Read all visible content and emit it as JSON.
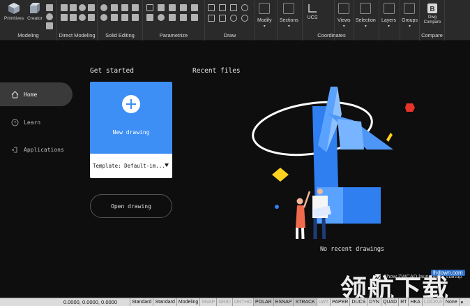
{
  "ribbon": {
    "modeling": {
      "label": "Modeling",
      "buttons": [
        "Primitives",
        "Creator"
      ]
    },
    "direct_modeling": {
      "label": "Direct Modeling"
    },
    "solid_editing": {
      "label": "Solid Editing"
    },
    "parametrize": {
      "label": "Parametrize"
    },
    "draw": {
      "label": "Draw"
    },
    "menus": [
      "Modify",
      "Sections",
      "Views",
      "Selection",
      "Layers",
      "Groups"
    ],
    "coordinates": {
      "label": "Coordinates",
      "button": "UCS"
    },
    "compare": {
      "label": "Compare",
      "button": "Dwg Compare"
    }
  },
  "nav": {
    "items": [
      {
        "label": "Home",
        "icon": "home-icon",
        "active": true
      },
      {
        "label": "Learn",
        "icon": "question-icon",
        "active": false
      },
      {
        "label": "Applications",
        "icon": "plugin-icon",
        "active": false
      }
    ]
  },
  "start": {
    "heading": "Get started",
    "new_drawing": "New drawing",
    "template": "Template: Default-im...",
    "open_drawing": "Open drawing"
  },
  "recent": {
    "heading": "Recent files",
    "empty": "No recent drawings"
  },
  "launcher": {
    "checkbox_label": "Show ZWCAD launcher at startup",
    "checked": true
  },
  "watermark": {
    "url": "lhdown.com",
    "text": "领航下载"
  },
  "status": {
    "coords": "0.0000, 0.0000, 0.0000",
    "items": [
      {
        "label": "Standard",
        "state": "on"
      },
      {
        "label": "Standard",
        "state": "on"
      },
      {
        "label": "Modeling",
        "state": "on"
      },
      {
        "label": "SNAP",
        "state": "off"
      },
      {
        "label": "GRID",
        "state": "off"
      },
      {
        "label": "ORTHO",
        "state": "off"
      },
      {
        "label": "POLAR",
        "state": "active"
      },
      {
        "label": "ESNAP",
        "state": "active"
      },
      {
        "label": "STRACK",
        "state": "active"
      },
      {
        "label": "LWT",
        "state": "off"
      },
      {
        "label": "PAPER",
        "state": "on"
      },
      {
        "label": "DUCS",
        "state": "on"
      },
      {
        "label": "DYN",
        "state": "on"
      },
      {
        "label": "QUAD",
        "state": "on"
      },
      {
        "label": "RT",
        "state": "on"
      },
      {
        "label": "HKA",
        "state": "on"
      },
      {
        "label": "LOCKUI",
        "state": "off"
      },
      {
        "label": "None",
        "state": "on"
      }
    ]
  },
  "colors": {
    "accent": "#3d8ef5",
    "background": "#0e0e0e",
    "ribbon": "#2a2a2a",
    "illustration_blue": "#2f7ff0",
    "illustration_yellow": "#ffd21f",
    "illustration_red": "#e8332b"
  }
}
